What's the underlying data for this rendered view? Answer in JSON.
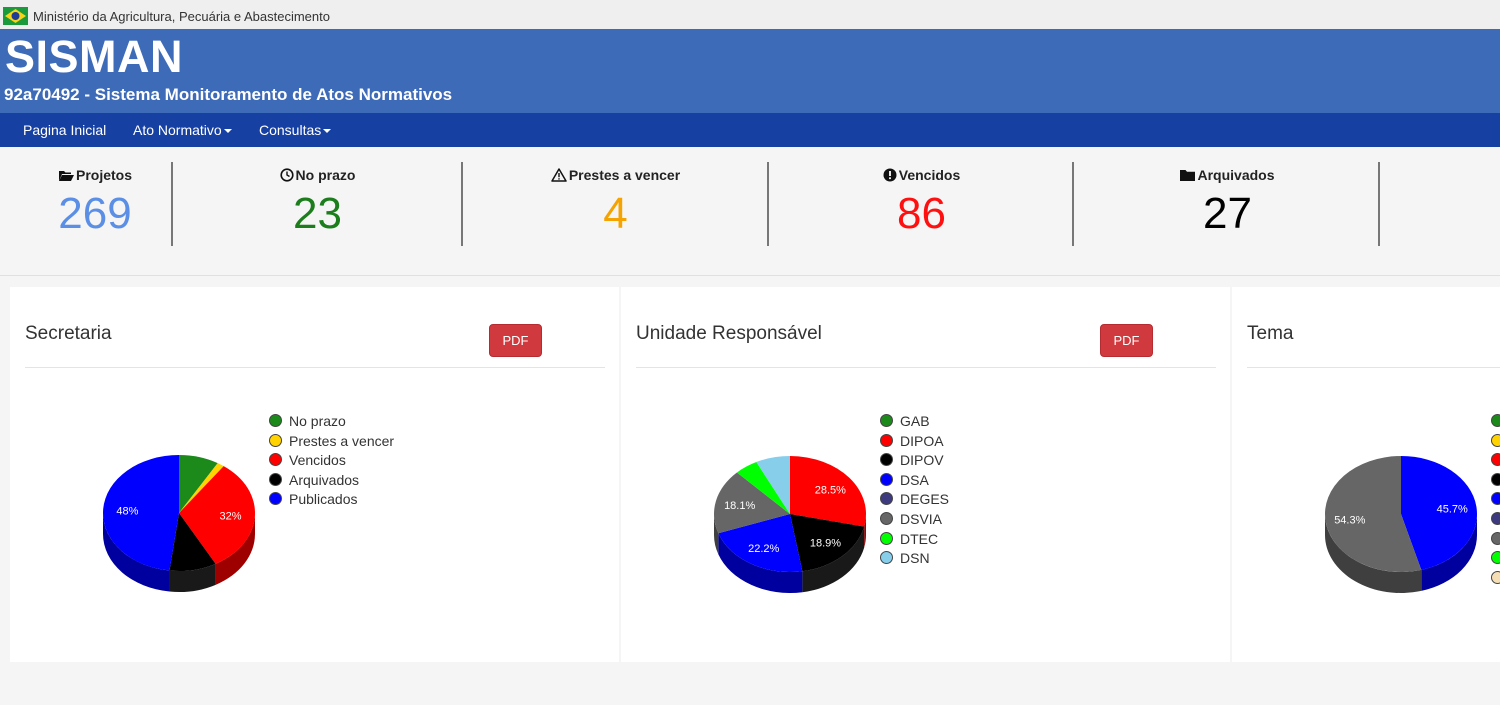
{
  "govbar": {
    "text": "Ministério da Agricultura, Pecuária e Abastecimento",
    "flag_icon": "brazil-flag-icon"
  },
  "header": {
    "title": "SISMAN",
    "subtitle": "92a70492 - Sistema Monitoramento de Atos Normativos"
  },
  "nav": [
    {
      "label": "Pagina Inicial",
      "dropdown": false
    },
    {
      "label": "Ato Normativo",
      "dropdown": true
    },
    {
      "label": "Consultas",
      "dropdown": true
    }
  ],
  "stats": [
    {
      "label": "Projetos",
      "value": "269",
      "icon": "folder-open-icon",
      "color": "#5b8fe6"
    },
    {
      "label": "No prazo",
      "value": "23",
      "icon": "clock-icon",
      "color": "#1b7d1b"
    },
    {
      "label": "Prestes a vencer",
      "value": "4",
      "icon": "warning-icon",
      "color": "#f5a300"
    },
    {
      "label": "Vencidos",
      "value": "86",
      "icon": "exclamation-circle-icon",
      "color": "#ff1010"
    },
    {
      "label": "Arquivados",
      "value": "27",
      "icon": "folder-icon",
      "color": "#000000"
    }
  ],
  "panels": [
    {
      "title": "Secretaria",
      "pdf_label": "PDF"
    },
    {
      "title": "Unidade Responsável",
      "pdf_label": "PDF"
    },
    {
      "title": "Tema",
      "pdf_label": ""
    }
  ],
  "chart_data": [
    {
      "type": "pie",
      "title": "Secretaria",
      "slices": [
        {
          "name": "No prazo",
          "value": 8.5,
          "color": "#1b8a1b",
          "label": ""
        },
        {
          "name": "Prestes a vencer",
          "value": 1.5,
          "color": "#ffd200",
          "label": ""
        },
        {
          "name": "Vencidos",
          "value": 32,
          "color": "#ff0000",
          "label": "32%"
        },
        {
          "name": "Arquivados",
          "value": 10,
          "color": "#000000",
          "label": ""
        },
        {
          "name": "Publicados",
          "value": 48,
          "color": "#0000ff",
          "label": "48%"
        }
      ]
    },
    {
      "type": "pie",
      "title": "Unidade Responsável",
      "slices": [
        {
          "name": "GAB",
          "value": 0,
          "color": "#1b8a1b",
          "label": ""
        },
        {
          "name": "DIPOA",
          "value": 28.5,
          "color": "#ff0000",
          "label": "28.5%"
        },
        {
          "name": "DIPOV",
          "value": 18.9,
          "color": "#000000",
          "label": "18.9%"
        },
        {
          "name": "DSA",
          "value": 22.2,
          "color": "#0000ff",
          "label": "22.2%"
        },
        {
          "name": "DEGES",
          "value": 0,
          "color": "#3d3a80",
          "label": ""
        },
        {
          "name": "DSVIA",
          "value": 18.1,
          "color": "#666666",
          "label": "18.1%"
        },
        {
          "name": "DTEC",
          "value": 5.0,
          "color": "#00ff00",
          "label": ""
        },
        {
          "name": "DSN",
          "value": 7.3,
          "color": "#87ceeb",
          "label": ""
        }
      ]
    },
    {
      "type": "pie",
      "title": "Tema",
      "slices": [
        {
          "name": "",
          "value": 45.7,
          "color": "#0000ff",
          "label": "45.7%"
        },
        {
          "name": "",
          "value": 54.3,
          "color": "#666666",
          "label": "54.3%"
        }
      ],
      "legend_colors": [
        "#1b8a1b",
        "#ffd200",
        "#ff0000",
        "#000000",
        "#0000ff",
        "#3d3a80",
        "#666666",
        "#00ff00",
        "#f5deb3"
      ]
    }
  ]
}
